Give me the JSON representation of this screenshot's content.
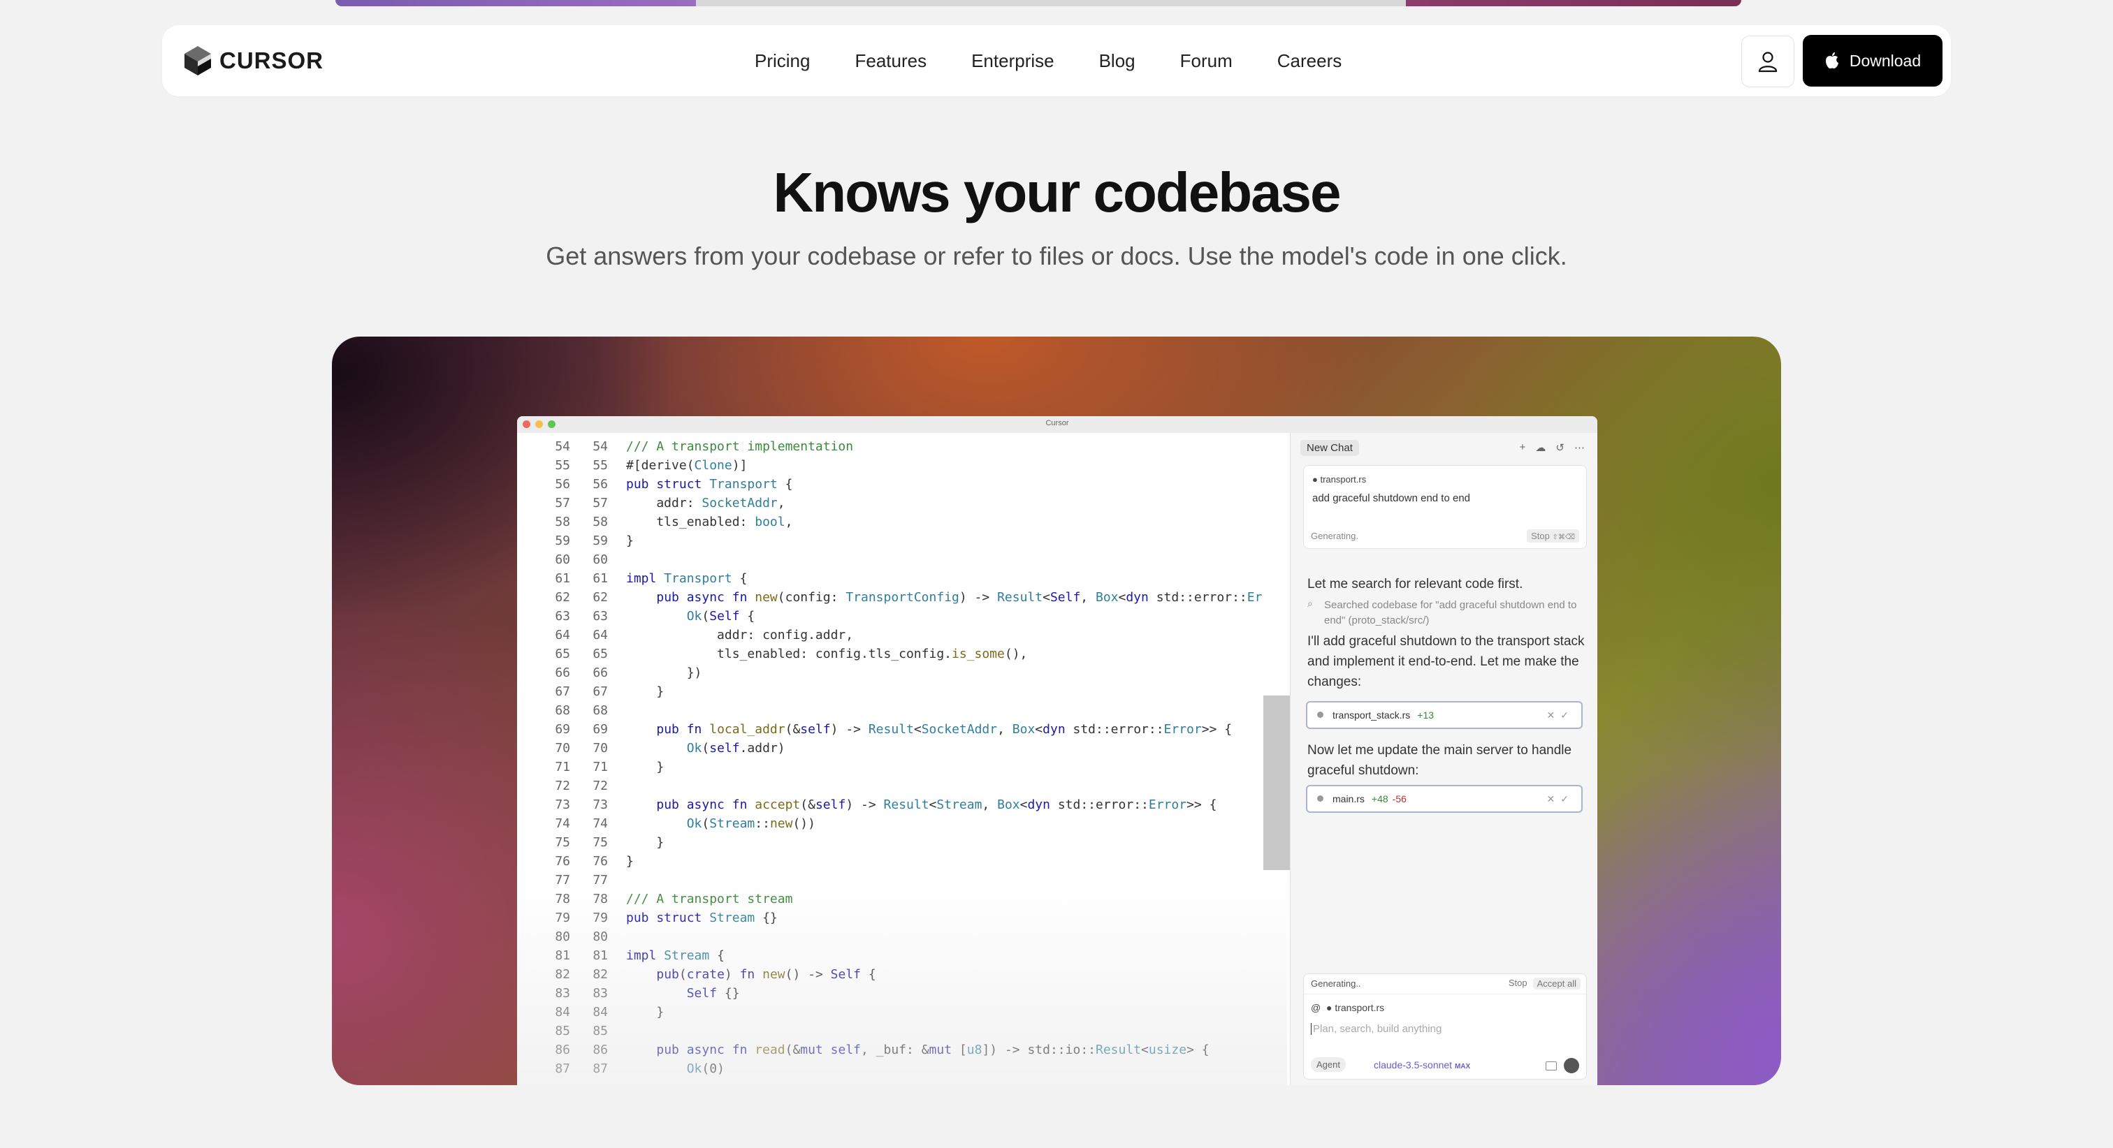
{
  "brand": {
    "name": "CURSOR"
  },
  "nav": {
    "links": [
      "Pricing",
      "Features",
      "Enterprise",
      "Blog",
      "Forum",
      "Careers"
    ],
    "download_label": "Download"
  },
  "hero": {
    "title": "Knows your codebase",
    "subtitle": "Get answers from your codebase or refer to files or docs. Use the model's code in one click."
  },
  "window": {
    "title": "Cursor"
  },
  "editor": {
    "lines": [
      {
        "n": "54",
        "code": "<span class=\"cm\">/// A transport implementation</span>"
      },
      {
        "n": "55",
        "code": "#[derive(<span class=\"ty\">Clone</span>)]"
      },
      {
        "n": "56",
        "code": "<span class=\"kw\">pub struct</span> <span class=\"ty\">Transport</span> {"
      },
      {
        "n": "57",
        "code": "    addr: <span class=\"ty\">SocketAddr</span>,"
      },
      {
        "n": "58",
        "code": "    tls_enabled: <span class=\"ty\">bool</span>,"
      },
      {
        "n": "59",
        "code": "}"
      },
      {
        "n": "60",
        "code": ""
      },
      {
        "n": "61",
        "code": "<span class=\"kw\">impl</span> <span class=\"ty\">Transport</span> {"
      },
      {
        "n": "62",
        "code": "    <span class=\"kw\">pub async fn</span> <span class=\"fn\">new</span>(config: <span class=\"ty\">TransportConfig</span>) -> <span class=\"ty\">Result</span>&lt;<span class=\"kw\">Self</span>, <span class=\"ty\">Box</span>&lt;<span class=\"kw\">dyn</span> std::error::<span class=\"ty\">Er</span>"
      },
      {
        "n": "63",
        "code": "        <span class=\"ty\">Ok</span>(<span class=\"kw\">Self</span> {"
      },
      {
        "n": "64",
        "code": "            addr: config.addr,"
      },
      {
        "n": "65",
        "code": "            tls_enabled: config.tls_config.<span class=\"fn\">is_some</span>(),"
      },
      {
        "n": "66",
        "code": "        })"
      },
      {
        "n": "67",
        "code": "    }"
      },
      {
        "n": "68",
        "code": ""
      },
      {
        "n": "69",
        "code": "    <span class=\"kw\">pub fn</span> <span class=\"fn\">local_addr</span>(&amp;<span class=\"kw\">self</span>) -> <span class=\"ty\">Result</span>&lt;<span class=\"ty\">SocketAddr</span>, <span class=\"ty\">Box</span>&lt;<span class=\"kw\">dyn</span> std::error::<span class=\"ty\">Error</span>&gt;&gt; {"
      },
      {
        "n": "70",
        "code": "        <span class=\"ty\">Ok</span>(<span class=\"kw\">self</span>.addr)"
      },
      {
        "n": "71",
        "code": "    }"
      },
      {
        "n": "72",
        "code": ""
      },
      {
        "n": "73",
        "code": "    <span class=\"kw\">pub async fn</span> <span class=\"fn\">accept</span>(&amp;<span class=\"kw\">self</span>) -> <span class=\"ty\">Result</span>&lt;<span class=\"ty\">Stream</span>, <span class=\"ty\">Box</span>&lt;<span class=\"kw\">dyn</span> std::error::<span class=\"ty\">Error</span>&gt;&gt; {"
      },
      {
        "n": "74",
        "code": "        <span class=\"ty\">Ok</span>(<span class=\"ty\">Stream</span>::<span class=\"fn\">new</span>())"
      },
      {
        "n": "75",
        "code": "    }"
      },
      {
        "n": "76",
        "code": "}"
      },
      {
        "n": "77",
        "code": ""
      },
      {
        "n": "78",
        "code": "<span class=\"cm\">/// A transport stream</span>"
      },
      {
        "n": "79",
        "code": "<span class=\"kw\">pub struct</span> <span class=\"ty\">Stream</span> {}"
      },
      {
        "n": "80",
        "code": ""
      },
      {
        "n": "81",
        "code": "<span class=\"kw\">impl</span> <span class=\"ty\">Stream</span> {"
      },
      {
        "n": "82",
        "code": "    <span class=\"kw\">pub</span>(<span class=\"kw\">crate</span>) <span class=\"kw\">fn</span> <span class=\"fn\">new</span>() -> <span class=\"kw\">Self</span> {"
      },
      {
        "n": "83",
        "code": "        <span class=\"kw\">Self</span> {}"
      },
      {
        "n": "84",
        "code": "    }"
      },
      {
        "n": "85",
        "code": ""
      },
      {
        "n": "86",
        "code": "    <span class=\"kw\">pub async fn</span> <span class=\"fn\">read</span>(&amp;<span class=\"kw\">mut self</span>, _buf: &amp;<span class=\"kw\">mut</span> [<span class=\"ty\">u8</span>]) -> std::io::<span class=\"ty\">Result</span>&lt;<span class=\"ty\">usize</span>&gt; {"
      },
      {
        "n": "87",
        "code": "        <span class=\"ty\">Ok</span>(0)"
      }
    ]
  },
  "chat": {
    "new_chat": "New Chat",
    "context_file": "transport.rs",
    "prompt": "add graceful shutdown end to end",
    "generating": "Generating.",
    "stop": "Stop",
    "stop_shortcut": "⇧⌘⌫",
    "msg1": "Let me search for relevant code first.",
    "search_note": "Searched codebase for \"add graceful shutdown end to end\" (proto_stack/src/)",
    "msg2": "I'll add graceful shutdown to the transport stack and implement it end-to-end. Let me make the changes:",
    "file1": {
      "name": "transport_stack.rs",
      "add": "+13",
      "del": ""
    },
    "msg3": "Now let me update the main server to handle graceful shutdown:",
    "file2": {
      "name": "main.rs",
      "add": "+48",
      "del": "-56"
    },
    "input": {
      "generating": "Generating..",
      "stop": "Stop",
      "accept_all": "Accept all",
      "attached": "transport.rs",
      "placeholder": "Plan, search, build anything",
      "mode": "Agent",
      "model": "claude-3.5-sonnet",
      "model_badge": "MAX"
    }
  }
}
